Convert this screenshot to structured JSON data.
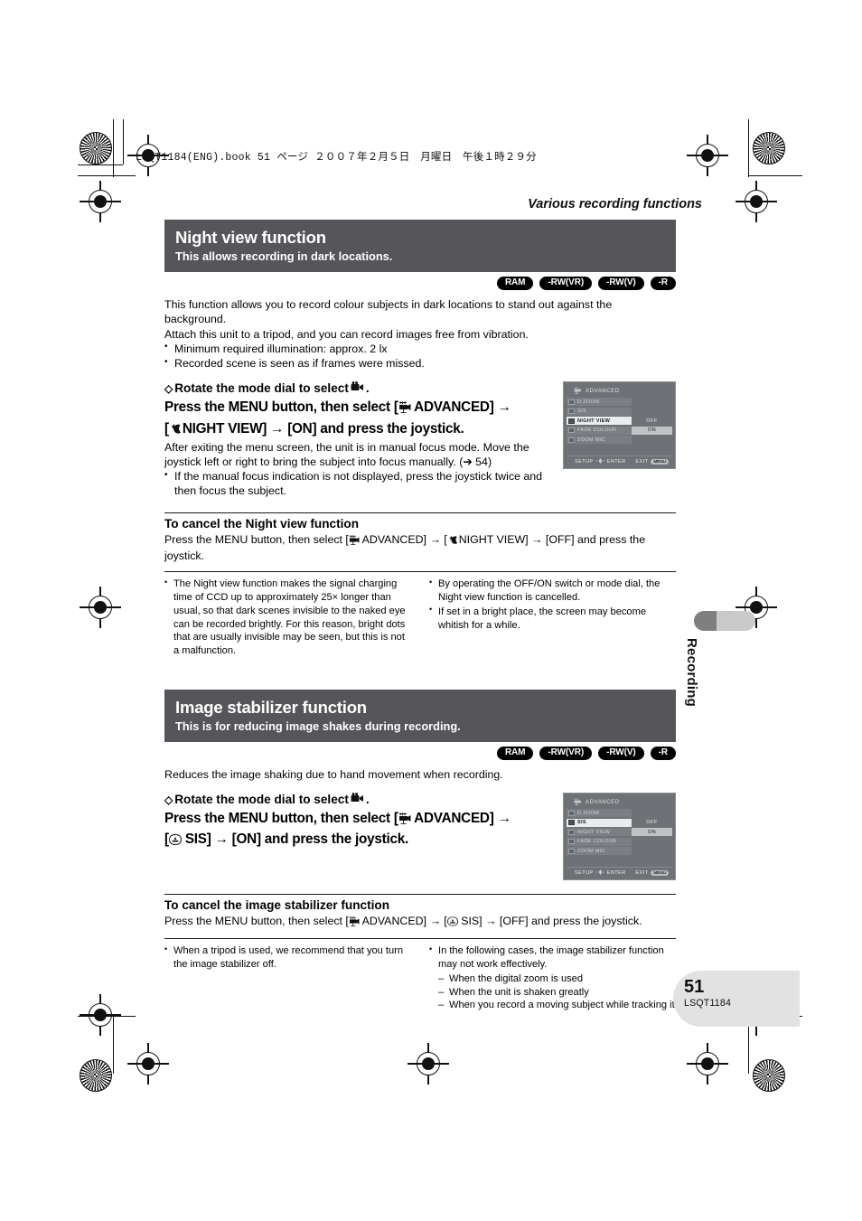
{
  "slug": "LSQT1184(ENG).book  51 ページ  ２００７年２月５日　月曜日　午後１時２９分",
  "running_head": "Various recording functions",
  "side_tab_label": "Recording",
  "page_number": "51",
  "page_code": "LSQT1184",
  "media_badges": [
    "RAM",
    "-RW(VR)",
    "-RW(V)",
    "-R"
  ],
  "sections": [
    {
      "title": "Night view function",
      "subtitle": "This allows recording in dark locations.",
      "intro_paragraphs": [
        "This function allows you to record colour subjects in dark locations to stand out against the background.",
        "Attach this unit to a tripod, and you can record images free from vibration."
      ],
      "intro_bullets": [
        "Minimum required illumination: approx. 2 lx",
        "Recorded scene is seen as if frames were missed."
      ],
      "step_dial": "Rotate the mode dial to select",
      "step_dial_suffix": ".",
      "step_main_line1": "Press the MENU button, then select [",
      "step_main_adv": "ADVANCED]",
      "step_main_arrow1": "→",
      "step_main_line2_open": "[",
      "step_main_item": "NIGHT VIEW]",
      "step_main_arrow2": "→",
      "step_main_tail": "[ON] and press the joystick.",
      "step_note": "After exiting the menu screen, the unit is in manual focus mode. Move the joystick left or right to bring the subject into focus manually. (➔ 54)",
      "step_note_bullets": [
        "If the manual focus indication is not displayed, press the joystick twice and then focus the subject."
      ],
      "cancel_head": "To cancel the Night view function",
      "cancel_text_pre": "Press the MENU button, then select [",
      "cancel_adv": "ADVANCED]",
      "cancel_mid": "→ [",
      "cancel_item": "NIGHT VIEW]",
      "cancel_tail": "→ [OFF] and press the joystick.",
      "notes_left": [
        "The Night view function makes the signal charging time of CCD up to approximately 25× longer than usual, so that dark scenes invisible to the naked eye can be recorded brightly. For this reason, bright dots that are usually invisible may be seen, but this is not a malfunction."
      ],
      "notes_right": [
        "By operating the OFF/ON switch or mode dial, the Night view function is cancelled.",
        "If set in a bright place, the screen may become whitish for a while."
      ]
    },
    {
      "title": "Image stabilizer function",
      "subtitle": "This is for reducing image shakes during recording.",
      "intro_paragraphs": [
        "Reduces the image shaking due to hand movement when recording."
      ],
      "intro_bullets": [],
      "step_dial": "Rotate the mode dial to select",
      "step_dial_suffix": ".",
      "step_main_line1": "Press the MENU button, then select [",
      "step_main_adv": "ADVANCED]",
      "step_main_arrow1": "→",
      "step_main_line2_open": "[",
      "step_main_item": "SIS]",
      "step_main_arrow2": "→",
      "step_main_tail": "[ON] and press the joystick.",
      "cancel_head": "To cancel the image stabilizer function",
      "cancel_text_pre": "Press the MENU button, then select [",
      "cancel_adv": "ADVANCED]",
      "cancel_mid": "→ [",
      "cancel_item": "SIS]",
      "cancel_tail": "→ [OFF] and press the joystick.",
      "notes_left": [
        "When a tripod is used, we recommend that you turn the image stabilizer off."
      ],
      "notes_right": [
        "In the following cases, the image stabilizer function may not work effectively."
      ],
      "notes_right_sub": [
        "When the digital zoom is used",
        "When the unit is shaken greatly",
        "When you record a moving subject while tracking it"
      ]
    }
  ],
  "lcd_menus": [
    {
      "title": "ADVANCED",
      "rows": [
        {
          "label": "D.ZOOM",
          "values": "",
          "selected": false
        },
        {
          "label": "SIS",
          "values": "",
          "selected": false
        },
        {
          "label": "NIGHT VIEW",
          "values": "OFF|ON",
          "selected": true
        },
        {
          "label": "FADE COLOUR",
          "values": "",
          "selected": false
        },
        {
          "label": "ZOOM MIC",
          "values": "",
          "selected": false
        }
      ],
      "value_off": "OFF",
      "value_on": "ON",
      "foot_setup": "SETUP",
      "foot_enter": "ENTER",
      "foot_exit": "EXIT",
      "foot_chip": "MENU"
    },
    {
      "title": "ADVANCED",
      "rows": [
        {
          "label": "D.ZOOM",
          "values": "",
          "selected": false
        },
        {
          "label": "SIS",
          "values": "OFF|ON",
          "selected": true
        },
        {
          "label": "NIGHT VIEW",
          "values": "",
          "selected": false
        },
        {
          "label": "FADE COLOUR",
          "values": "",
          "selected": false
        },
        {
          "label": "ZOOM MIC",
          "values": "",
          "selected": false
        }
      ],
      "value_off": "OFF",
      "value_on": "ON",
      "foot_setup": "SETUP",
      "foot_enter": "ENTER",
      "foot_exit": "EXIT",
      "foot_chip": "MENU"
    }
  ]
}
